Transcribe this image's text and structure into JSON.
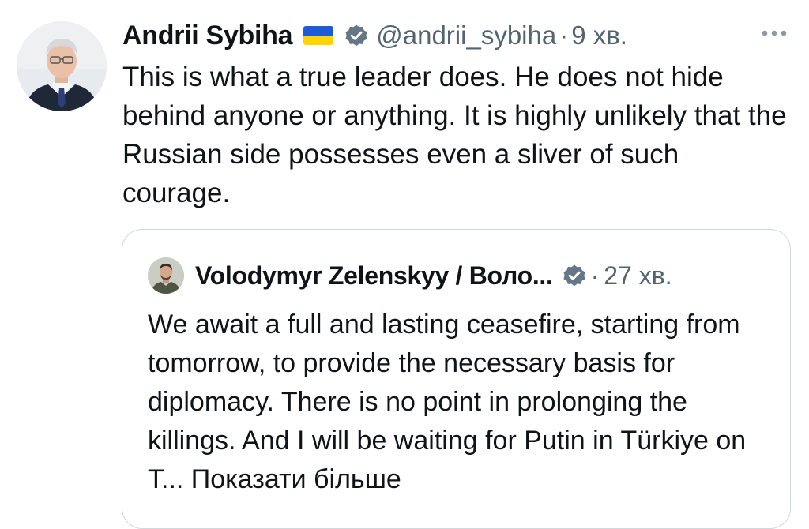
{
  "tweet": {
    "author": {
      "display_name": "Andrii Sybiha",
      "handle": "@andrii_sybiha",
      "flag": "ukraine-flag",
      "verified": true
    },
    "separator": "·",
    "time": "9 хв.",
    "text": "This is what a true leader does. He does not hide behind anyone or anything. It is highly unlikely that the Russian side possesses even a sliver of such courage."
  },
  "quote": {
    "author": {
      "display_name": "Volodymyr Zelenskyy / Воло...",
      "verified": true
    },
    "separator": "·",
    "time": "27 хв.",
    "text": "We await a full and lasting ceasefire, starting from tomorrow, to provide the necessary basis for diplomacy. There is no point in prolonging the killings. And I will be waiting for Putin in Türkiye on T...",
    "show_more": "Показати більше"
  },
  "colors": {
    "text_primary": "#0f1419",
    "text_secondary": "#536471",
    "card_border": "#cfd9de",
    "verified_badge": "#657786",
    "flag_blue": "#1f5bd6",
    "flag_yellow": "#ffd500"
  }
}
